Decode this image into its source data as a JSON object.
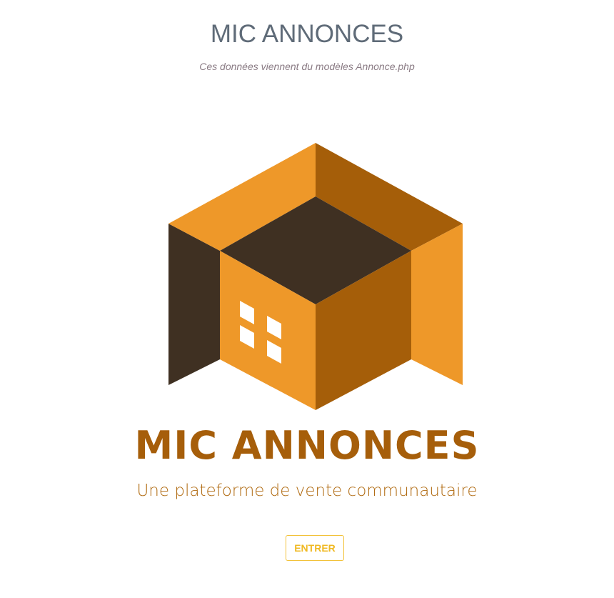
{
  "header": {
    "title": "MIC ANNONCES",
    "subtitle": "Ces données viennent du modèles Annonce.php"
  },
  "logo": {
    "icon": "house-box-logo-icon",
    "brand_name": "MIC ANNONCES",
    "tagline": "Une plateforme de vente communautaire",
    "colors": {
      "orange": "#ee9829",
      "dark_orange": "#a55e09",
      "dark_brown": "#3f3022",
      "brand_text": "#a65e0a"
    }
  },
  "actions": {
    "enter_label": "ENTRER",
    "enter_color": "#f0b923"
  }
}
